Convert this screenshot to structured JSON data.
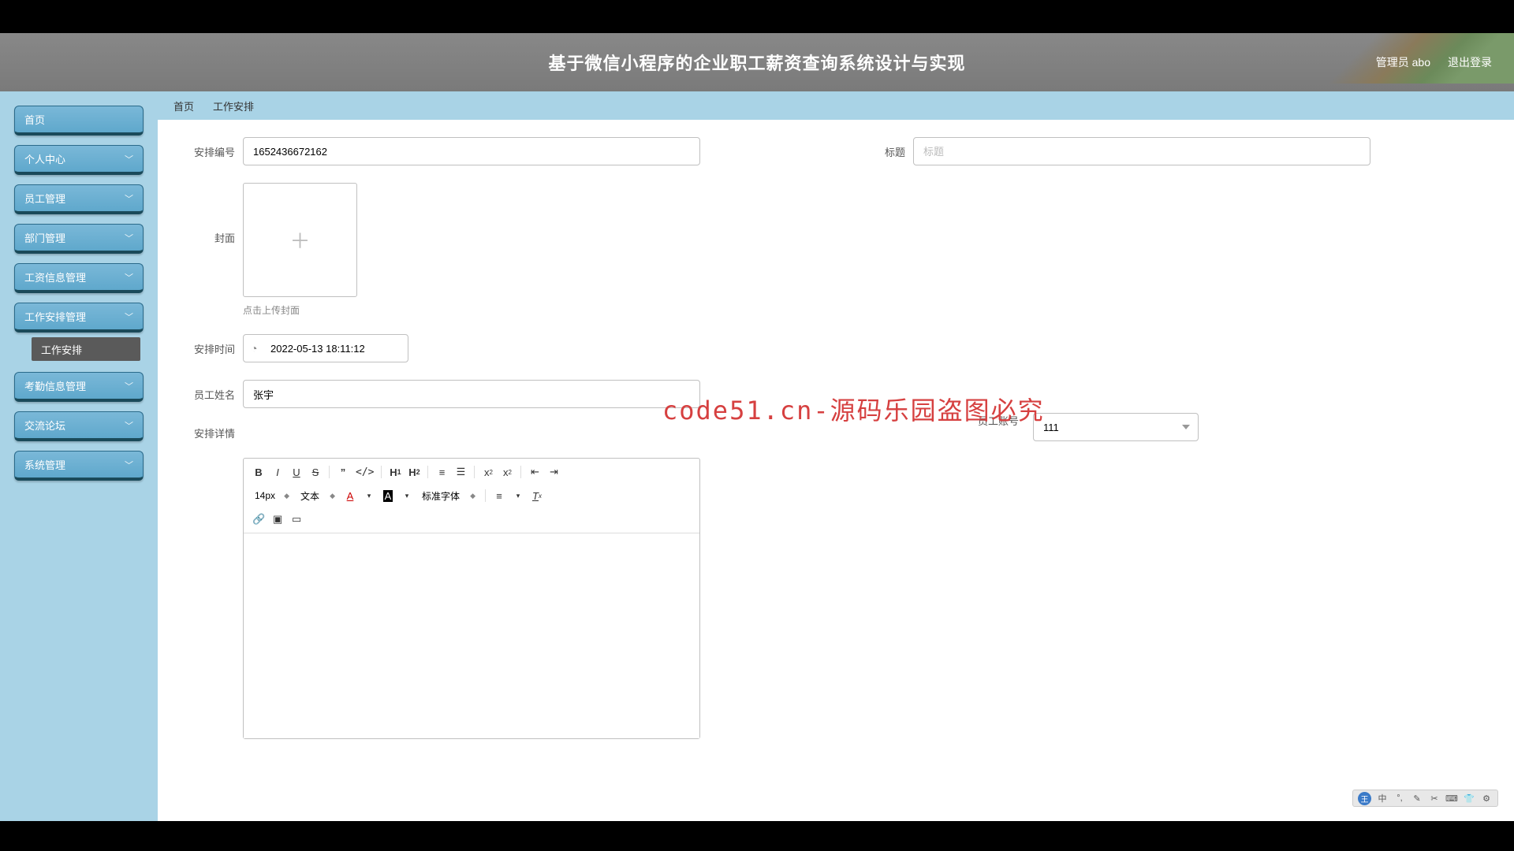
{
  "header": {
    "title": "基于微信小程序的企业职工薪资查询系统设计与实现",
    "admin": "管理员 abo",
    "logout": "退出登录"
  },
  "sidebar": {
    "items": [
      {
        "label": "首页",
        "expandable": false
      },
      {
        "label": "个人中心",
        "expandable": true
      },
      {
        "label": "员工管理",
        "expandable": true
      },
      {
        "label": "部门管理",
        "expandable": true
      },
      {
        "label": "工资信息管理",
        "expandable": true
      },
      {
        "label": "工作安排管理",
        "expandable": true
      },
      {
        "label": "考勤信息管理",
        "expandable": true
      },
      {
        "label": "交流论坛",
        "expandable": true
      },
      {
        "label": "系统管理",
        "expandable": true
      }
    ],
    "sub_after_index": 5,
    "sub_label": "工作安排"
  },
  "breadcrumb": {
    "a": "首页",
    "b": "工作安排"
  },
  "form": {
    "arrange_no": {
      "label": "安排编号",
      "value": "1652436672162"
    },
    "title": {
      "label": "标题",
      "placeholder": "标题",
      "value": ""
    },
    "cover": {
      "label": "封面",
      "hint": "点击上传封面"
    },
    "arrange_time": {
      "label": "安排时间",
      "value": "2022-05-13 18:11:12"
    },
    "emp_acct": {
      "label": "员工账号",
      "value": "111"
    },
    "emp_name": {
      "label": "员工姓名",
      "value": "张宇"
    },
    "details": {
      "label": "安排详情"
    }
  },
  "editor_toolbar": {
    "size": "14px",
    "text_type": "文本",
    "font": "标准字体"
  },
  "watermark": "code51.cn-源码乐园盗图必究",
  "bg_mark": "code51.cn",
  "ime": {
    "char": "中"
  }
}
